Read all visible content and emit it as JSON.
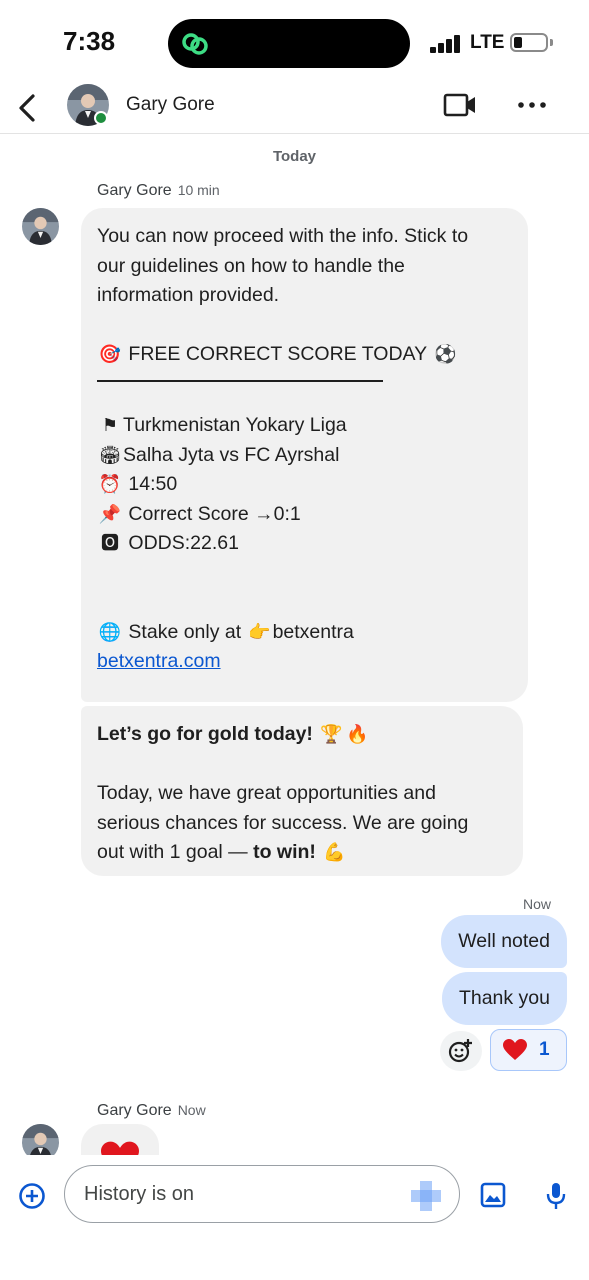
{
  "status_bar": {
    "time": "7:38",
    "network": "LTE",
    "battery_level": 0.25
  },
  "header": {
    "contact_name": "Gary Gore",
    "online": true
  },
  "chat": {
    "date_separator": "Today",
    "incoming_group_1": {
      "sender": "Gary Gore",
      "time": "10 min",
      "message_1": {
        "intro_lines": [
          "You can now proceed with the info. Stick to",
          "our guidelines on how to handle the",
          "information provided."
        ],
        "headline": "FREE CORRECT SCORE TODAY",
        "league": "Turkmenistan Yokary Liga",
        "match": "Salha Jyta vs FC Ayrshal",
        "kickoff": "14:50",
        "score": "Correct Score →0:1",
        "odds": "ODDS:22.61",
        "stake": "Stake only at",
        "stake_brand": "betxentra",
        "link": "betxentra.com"
      },
      "message_2": {
        "headline": "Let’s go for gold today!",
        "body_lines": [
          "Today, we have great opportunities and",
          "serious chances for success. We are going",
          "out with 1 goal —"
        ],
        "body_bold": "to win!"
      }
    },
    "outgoing_group": {
      "time": "Now",
      "messages": [
        "Well noted",
        "Thank you"
      ],
      "reaction_count": "1"
    },
    "incoming_group_2": {
      "sender": "Gary Gore",
      "time": "Now"
    }
  },
  "composer": {
    "placeholder": "History is on"
  },
  "colors": {
    "accent": "#0b57d0",
    "outgoing_bubble": "#d3e3fd",
    "incoming_bubble": "#f1f1f1",
    "online": "#1e8e3e"
  },
  "icons": [
    "back-arrow-icon",
    "video-call-icon",
    "more-vert-icon",
    "add-reaction-icon",
    "heart-icon",
    "add-circle-icon",
    "emoji-sticker-icon",
    "gallery-icon",
    "mic-icon"
  ]
}
